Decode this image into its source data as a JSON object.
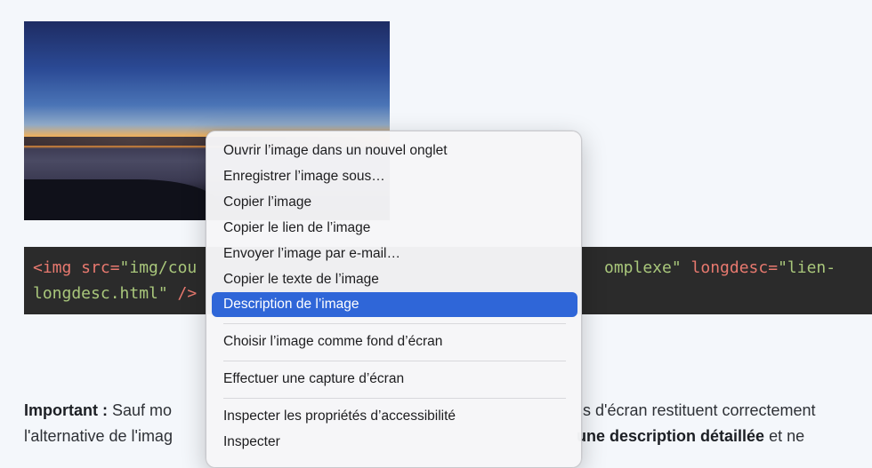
{
  "code": {
    "line1": [
      {
        "text": "<img src=",
        "kind": "tag"
      },
      {
        "text": "\"img/cou",
        "kind": "str"
      },
      {
        "text": "omplexe\"",
        "kind": "str"
      },
      {
        "text": " longdesc=",
        "kind": "tag"
      },
      {
        "text": "\"lien-",
        "kind": "str"
      }
    ],
    "line2": [
      {
        "text": "longdesc.html\"",
        "kind": "str"
      },
      {
        "text": " />",
        "kind": "tag"
      }
    ]
  },
  "paragraph": {
    "line1_bold": "Important :",
    "line1_a": " Sauf mo",
    "line1_b": "s d'écran restituent correctement",
    "line2_a": "l'alternative de l'imag",
    "line2_bold": "une description détaillée",
    "line2_b": " et ne"
  },
  "context_menu": {
    "items": [
      "Ouvrir l’image dans un nouvel onglet",
      "Enregistrer l’image sous…",
      "Copier l’image",
      "Copier le lien de l’image",
      "Envoyer l’image par e-mail…",
      "Copier le texte de l’image",
      "Description de l’image",
      "Choisir l’image comme fond d’écran",
      "Effectuer une capture d’écran",
      "Inspecter les propriétés d’accessibilité",
      "Inspecter"
    ],
    "selected_index": 6
  },
  "colors": {
    "selection": "#2f66d8",
    "code_background": "#2b2b2b",
    "code_tag": "#e8796f",
    "code_string": "#a9c77b"
  }
}
